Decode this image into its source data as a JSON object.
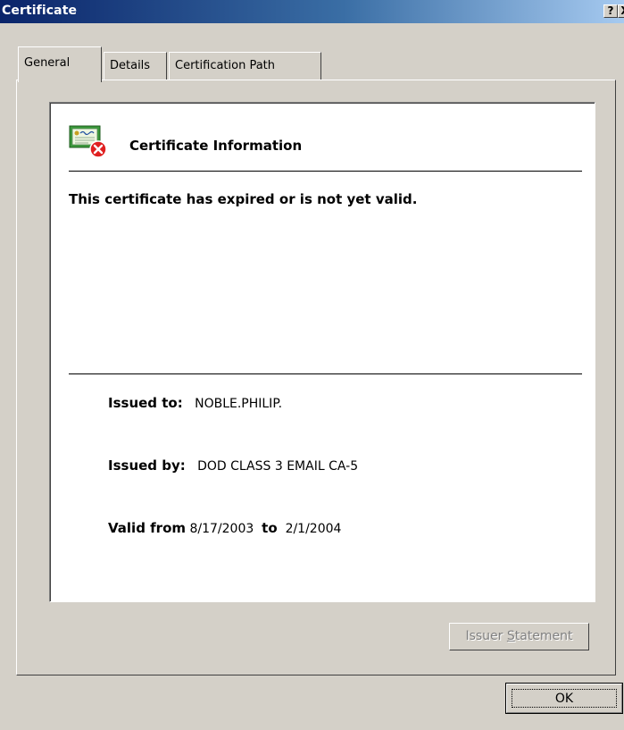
{
  "window": {
    "title": "Certificate",
    "help_glyph": "?",
    "close_glyph": "X"
  },
  "tabs": [
    {
      "label": "General",
      "active": true
    },
    {
      "label": "Details",
      "active": false
    },
    {
      "label": "Certification Path",
      "active": false
    }
  ],
  "info": {
    "heading": "Certificate Information",
    "warning": "This certificate has expired or is not yet valid.",
    "issued_to_label": "Issued to:",
    "issued_to_value": "NOBLE.PHILIP.",
    "issued_by_label": "Issued by:",
    "issued_by_value": "DOD CLASS 3 EMAIL CA-5",
    "valid_from_label": "Valid from",
    "valid_from_value": "8/17/2003",
    "valid_to_label": "to",
    "valid_to_value": "2/1/2004",
    "icon": "certificate-error-icon"
  },
  "buttons": {
    "issuer_statement_pre": "Issuer ",
    "issuer_statement_accel": "S",
    "issuer_statement_post": "tatement",
    "ok": "OK"
  },
  "colors": {
    "titlebar_start": "#0a246a",
    "titlebar_end": "#a6caf0",
    "face": "#d4d0c8",
    "error_red": "#e02020",
    "cert_green": "#3a9a3a"
  }
}
